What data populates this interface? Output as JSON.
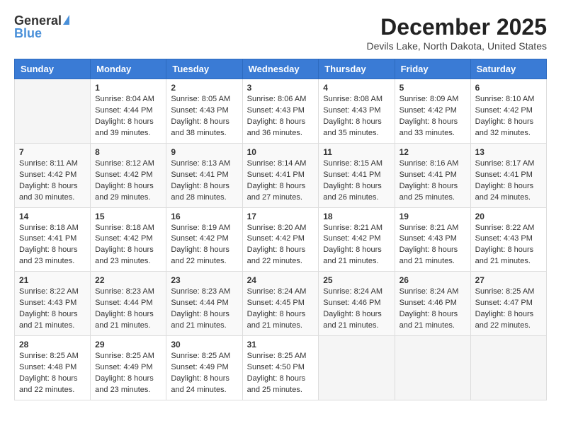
{
  "header": {
    "logo_general": "General",
    "logo_blue": "Blue",
    "month": "December 2025",
    "location": "Devils Lake, North Dakota, United States"
  },
  "days_of_week": [
    "Sunday",
    "Monday",
    "Tuesday",
    "Wednesday",
    "Thursday",
    "Friday",
    "Saturday"
  ],
  "weeks": [
    [
      {
        "day": "",
        "sunrise": "",
        "sunset": "",
        "daylight": ""
      },
      {
        "day": "1",
        "sunrise": "Sunrise: 8:04 AM",
        "sunset": "Sunset: 4:44 PM",
        "daylight": "Daylight: 8 hours and 39 minutes."
      },
      {
        "day": "2",
        "sunrise": "Sunrise: 8:05 AM",
        "sunset": "Sunset: 4:43 PM",
        "daylight": "Daylight: 8 hours and 38 minutes."
      },
      {
        "day": "3",
        "sunrise": "Sunrise: 8:06 AM",
        "sunset": "Sunset: 4:43 PM",
        "daylight": "Daylight: 8 hours and 36 minutes."
      },
      {
        "day": "4",
        "sunrise": "Sunrise: 8:08 AM",
        "sunset": "Sunset: 4:43 PM",
        "daylight": "Daylight: 8 hours and 35 minutes."
      },
      {
        "day": "5",
        "sunrise": "Sunrise: 8:09 AM",
        "sunset": "Sunset: 4:42 PM",
        "daylight": "Daylight: 8 hours and 33 minutes."
      },
      {
        "day": "6",
        "sunrise": "Sunrise: 8:10 AM",
        "sunset": "Sunset: 4:42 PM",
        "daylight": "Daylight: 8 hours and 32 minutes."
      }
    ],
    [
      {
        "day": "7",
        "sunrise": "Sunrise: 8:11 AM",
        "sunset": "Sunset: 4:42 PM",
        "daylight": "Daylight: 8 hours and 30 minutes."
      },
      {
        "day": "8",
        "sunrise": "Sunrise: 8:12 AM",
        "sunset": "Sunset: 4:42 PM",
        "daylight": "Daylight: 8 hours and 29 minutes."
      },
      {
        "day": "9",
        "sunrise": "Sunrise: 8:13 AM",
        "sunset": "Sunset: 4:41 PM",
        "daylight": "Daylight: 8 hours and 28 minutes."
      },
      {
        "day": "10",
        "sunrise": "Sunrise: 8:14 AM",
        "sunset": "Sunset: 4:41 PM",
        "daylight": "Daylight: 8 hours and 27 minutes."
      },
      {
        "day": "11",
        "sunrise": "Sunrise: 8:15 AM",
        "sunset": "Sunset: 4:41 PM",
        "daylight": "Daylight: 8 hours and 26 minutes."
      },
      {
        "day": "12",
        "sunrise": "Sunrise: 8:16 AM",
        "sunset": "Sunset: 4:41 PM",
        "daylight": "Daylight: 8 hours and 25 minutes."
      },
      {
        "day": "13",
        "sunrise": "Sunrise: 8:17 AM",
        "sunset": "Sunset: 4:41 PM",
        "daylight": "Daylight: 8 hours and 24 minutes."
      }
    ],
    [
      {
        "day": "14",
        "sunrise": "Sunrise: 8:18 AM",
        "sunset": "Sunset: 4:41 PM",
        "daylight": "Daylight: 8 hours and 23 minutes."
      },
      {
        "day": "15",
        "sunrise": "Sunrise: 8:18 AM",
        "sunset": "Sunset: 4:42 PM",
        "daylight": "Daylight: 8 hours and 23 minutes."
      },
      {
        "day": "16",
        "sunrise": "Sunrise: 8:19 AM",
        "sunset": "Sunset: 4:42 PM",
        "daylight": "Daylight: 8 hours and 22 minutes."
      },
      {
        "day": "17",
        "sunrise": "Sunrise: 8:20 AM",
        "sunset": "Sunset: 4:42 PM",
        "daylight": "Daylight: 8 hours and 22 minutes."
      },
      {
        "day": "18",
        "sunrise": "Sunrise: 8:21 AM",
        "sunset": "Sunset: 4:42 PM",
        "daylight": "Daylight: 8 hours and 21 minutes."
      },
      {
        "day": "19",
        "sunrise": "Sunrise: 8:21 AM",
        "sunset": "Sunset: 4:43 PM",
        "daylight": "Daylight: 8 hours and 21 minutes."
      },
      {
        "day": "20",
        "sunrise": "Sunrise: 8:22 AM",
        "sunset": "Sunset: 4:43 PM",
        "daylight": "Daylight: 8 hours and 21 minutes."
      }
    ],
    [
      {
        "day": "21",
        "sunrise": "Sunrise: 8:22 AM",
        "sunset": "Sunset: 4:43 PM",
        "daylight": "Daylight: 8 hours and 21 minutes."
      },
      {
        "day": "22",
        "sunrise": "Sunrise: 8:23 AM",
        "sunset": "Sunset: 4:44 PM",
        "daylight": "Daylight: 8 hours and 21 minutes."
      },
      {
        "day": "23",
        "sunrise": "Sunrise: 8:23 AM",
        "sunset": "Sunset: 4:44 PM",
        "daylight": "Daylight: 8 hours and 21 minutes."
      },
      {
        "day": "24",
        "sunrise": "Sunrise: 8:24 AM",
        "sunset": "Sunset: 4:45 PM",
        "daylight": "Daylight: 8 hours and 21 minutes."
      },
      {
        "day": "25",
        "sunrise": "Sunrise: 8:24 AM",
        "sunset": "Sunset: 4:46 PM",
        "daylight": "Daylight: 8 hours and 21 minutes."
      },
      {
        "day": "26",
        "sunrise": "Sunrise: 8:24 AM",
        "sunset": "Sunset: 4:46 PM",
        "daylight": "Daylight: 8 hours and 21 minutes."
      },
      {
        "day": "27",
        "sunrise": "Sunrise: 8:25 AM",
        "sunset": "Sunset: 4:47 PM",
        "daylight": "Daylight: 8 hours and 22 minutes."
      }
    ],
    [
      {
        "day": "28",
        "sunrise": "Sunrise: 8:25 AM",
        "sunset": "Sunset: 4:48 PM",
        "daylight": "Daylight: 8 hours and 22 minutes."
      },
      {
        "day": "29",
        "sunrise": "Sunrise: 8:25 AM",
        "sunset": "Sunset: 4:49 PM",
        "daylight": "Daylight: 8 hours and 23 minutes."
      },
      {
        "day": "30",
        "sunrise": "Sunrise: 8:25 AM",
        "sunset": "Sunset: 4:49 PM",
        "daylight": "Daylight: 8 hours and 24 minutes."
      },
      {
        "day": "31",
        "sunrise": "Sunrise: 8:25 AM",
        "sunset": "Sunset: 4:50 PM",
        "daylight": "Daylight: 8 hours and 25 minutes."
      },
      {
        "day": "",
        "sunrise": "",
        "sunset": "",
        "daylight": ""
      },
      {
        "day": "",
        "sunrise": "",
        "sunset": "",
        "daylight": ""
      },
      {
        "day": "",
        "sunrise": "",
        "sunset": "",
        "daylight": ""
      }
    ]
  ]
}
